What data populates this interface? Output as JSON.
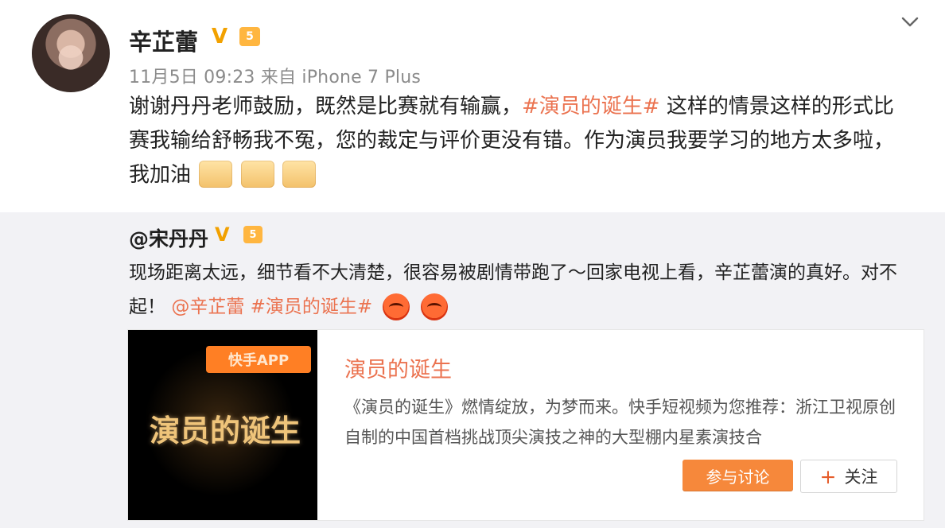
{
  "header": {
    "name": "辛芷蕾",
    "time": "11月5日 09:23",
    "source_prefix": "来自",
    "source": "iPhone 7 Plus"
  },
  "post": {
    "text_before_tag": "谢谢丹丹老师鼓励，既然是比赛就有输赢，",
    "tag": "#演员的诞生#",
    "text_after_tag": " 这样的情景这样的形式比赛我输给舒畅我不冤，您的裁定与评价更没有错。作为演员我要学习的地方太多啦，我加油"
  },
  "quote": {
    "name": "@宋丹丹",
    "text_main": "现场距离太远，细节看不大清楚，很容易被剧情带跑了～回家电视上看，辛芷蕾演的真好。对不起！",
    "mention": "@辛芷蕾",
    "tag": "#演员的诞生#"
  },
  "card": {
    "app_badge": "快手APP",
    "thumb_title": "演员的诞生",
    "title": "演员的诞生",
    "desc": "《演员的诞生》燃情绽放，为梦而来。快手短视频为您推荐：浙江卫视原创自制的中国首档挑战顶尖演技之神的大型棚内星素演技合",
    "join_label": "参与讨论",
    "follow_label": "关注"
  },
  "icons": {
    "verified": "verified-icon",
    "level": "level-icon",
    "chevron": "chevron-down-icon",
    "muscle": "muscle-emoji-icon",
    "angry": "angry-face-icon",
    "plus": "plus-icon"
  },
  "colors": {
    "accent": "#eb7350",
    "verified": "#f2a100",
    "button": "#f6883b"
  }
}
